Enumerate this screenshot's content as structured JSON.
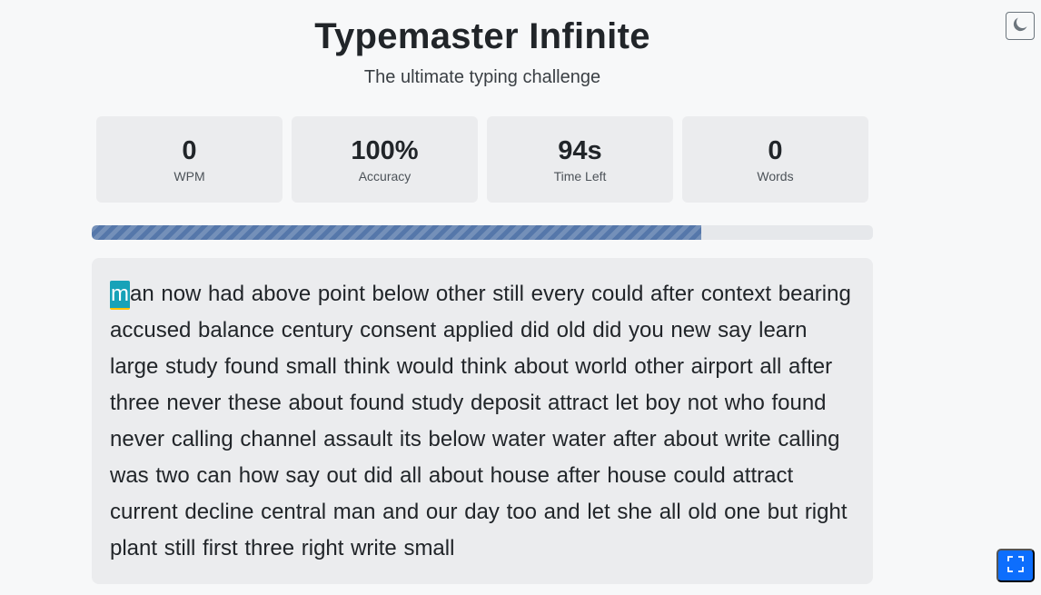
{
  "header": {
    "title": "Typemaster Infinite",
    "subtitle": "The ultimate typing challenge"
  },
  "stats": [
    {
      "value": "0",
      "label": "WPM"
    },
    {
      "value": "100%",
      "label": "Accuracy"
    },
    {
      "value": "94s",
      "label": "Time Left"
    },
    {
      "value": "0",
      "label": "Words"
    }
  ],
  "progress": {
    "fraction": 0.78
  },
  "typing": {
    "current_char": "m",
    "remaining_text": "an now had above point below other still every could after context bearing accused balance century consent applied did old did you new say learn large study found small think would think about world other airport all after three never these about found study deposit attract let boy not who found never calling channel assault its below water water after about write calling was two can how say out did all about house after house could attract current decline central man and our day too and let she all old one but right plant still first three right write small"
  },
  "controls": {
    "theme_toggle_icon": "moon-icon",
    "fullscreen_icon": "fullscreen-icon"
  },
  "colors": {
    "progress_fill": "#5577aa",
    "cursor_highlight": "#17a2b8",
    "cursor_underline": "#ffc107",
    "fullscreen_button": "#0d6efd"
  }
}
